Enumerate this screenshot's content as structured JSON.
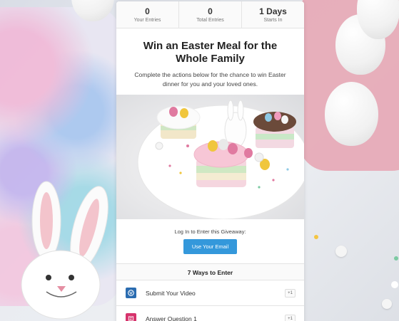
{
  "stats": [
    {
      "value": "0",
      "label": "Your Entries"
    },
    {
      "value": "0",
      "label": "Total Entries"
    },
    {
      "value": "1 Days",
      "label": "Starts In"
    }
  ],
  "giveaway": {
    "title": "Win an Easter Meal for the Whole Family",
    "description": "Complete the actions below for the chance to win Easter dinner for you and your loved ones."
  },
  "login": {
    "label": "Log In to Enter this Giveaway:",
    "button_label": "Use Your Email"
  },
  "ways": {
    "header": "7 Ways to Enter",
    "items": [
      {
        "label": "Submit Your Video",
        "points": "+1",
        "icon": "video-icon",
        "icon_color": "#2b6cb0"
      },
      {
        "label": "Answer Question 1",
        "points": "+1",
        "icon": "question-icon",
        "icon_color": "#d6336c"
      }
    ]
  },
  "colors": {
    "accent": "#3498db"
  }
}
